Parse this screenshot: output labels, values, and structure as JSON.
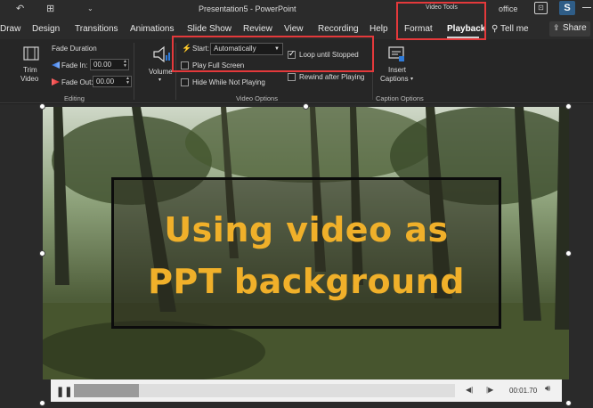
{
  "titlebar": {
    "title": "Presentation5 - PowerPoint",
    "context_tools": "Video Tools",
    "account": "office",
    "account_icon": "S"
  },
  "tabs": [
    {
      "label": "Draw"
    },
    {
      "label": "Design"
    },
    {
      "label": "Transitions"
    },
    {
      "label": "Animations"
    },
    {
      "label": "Slide Show"
    },
    {
      "label": "Review"
    },
    {
      "label": "View"
    },
    {
      "label": "Recording"
    },
    {
      "label": "Help"
    },
    {
      "label": "Format"
    },
    {
      "label": "Playback",
      "active": true
    }
  ],
  "tellme": "Tell me",
  "share": "Share",
  "ribbon": {
    "editing": {
      "trim_label_1": "Trim",
      "trim_label_2": "Video",
      "fade_duration": "Fade Duration",
      "fade_in_label": "Fade In:",
      "fade_in_value": "00.00",
      "fade_out_label": "Fade Out:",
      "fade_out_value": "00.00",
      "group_name": "Editing"
    },
    "volume_label": "Volume",
    "video_options": {
      "start_label": "Start:",
      "start_value": "Automatically",
      "play_full_screen": "Play Full Screen",
      "play_full_screen_checked": false,
      "hide_while_not_playing": "Hide While Not Playing",
      "hide_checked": false,
      "loop_until_stopped": "Loop until Stopped",
      "loop_checked": true,
      "rewind_after_playing": "Rewind after Playing",
      "rewind_checked": false,
      "group_name": "Video Options"
    },
    "captions": {
      "insert_label_1": "Insert",
      "insert_label_2": "Captions",
      "group_name": "Caption Options"
    }
  },
  "slide": {
    "headline_line1": "Using video as",
    "headline_line2": "PPT background",
    "headline_color": "#f0b02a"
  },
  "player": {
    "time": "00:01.70",
    "progress_fraction": 0.17
  },
  "colors": {
    "highlight": "#e4393b",
    "ribbon_bg": "#262626"
  }
}
